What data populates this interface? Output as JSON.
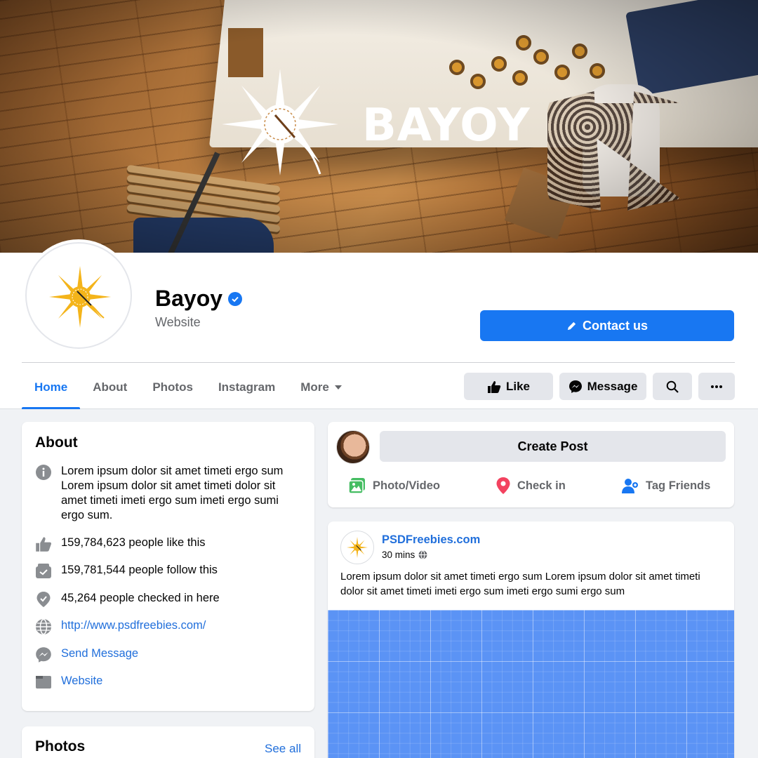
{
  "cover": {
    "brand_text": "BAYOY"
  },
  "page": {
    "name": "Bayoy",
    "category": "Website",
    "verified": true
  },
  "header": {
    "contact_label": "Contact us"
  },
  "tabs": [
    {
      "label": "Home",
      "active": true
    },
    {
      "label": "About"
    },
    {
      "label": "Photos"
    },
    {
      "label": "Instagram"
    },
    {
      "label": "More"
    }
  ],
  "actions": {
    "like": "Like",
    "message": "Message"
  },
  "about": {
    "title": "About",
    "description": "Lorem ipsum dolor sit amet timeti ergo sum Lorem ipsum dolor sit amet timeti dolor sit amet timeti imeti ergo sum imeti ergo sumi ergo sum.",
    "likes": "159,784,623 people like this",
    "follows": "159,781,544 people follow this",
    "checkins": "45,264 people checked in here",
    "url": "http://www.psdfreebies.com/",
    "send_message": "Send Message",
    "website": "Website"
  },
  "photos": {
    "title": "Photos",
    "see_all": "See all"
  },
  "create_post": {
    "label": "Create Post",
    "options": [
      "Photo/Video",
      "Check in",
      "Tag Friends"
    ]
  },
  "post": {
    "author": "PSDFreebies.com",
    "time": "30 mins",
    "text": "Lorem ipsum dolor sit amet timeti ergo sum Lorem ipsum dolor sit amet timeti dolor sit amet timeti imeti ergo sum imeti ergo sumi ergo sum"
  },
  "colors": {
    "accent": "#1877f2",
    "link": "#216fdb",
    "background": "#f0f2f5",
    "logo_sun": "#f4b41a",
    "media": "#5b93f5"
  }
}
